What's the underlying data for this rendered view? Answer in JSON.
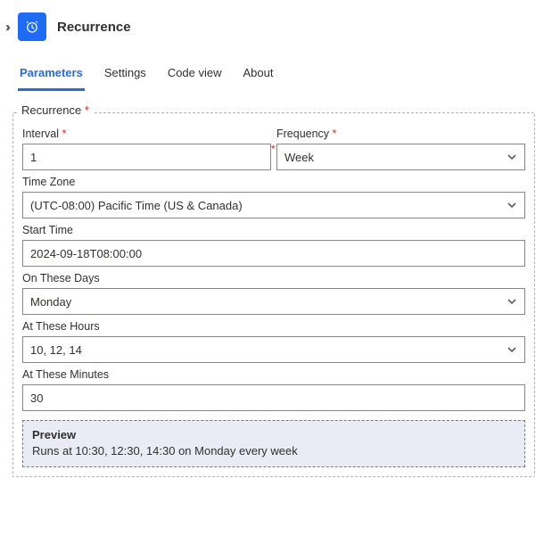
{
  "header": {
    "title": "Recurrence",
    "icon": "clock-icon"
  },
  "tabs": {
    "items": [
      {
        "label": "Parameters",
        "active": true
      },
      {
        "label": "Settings",
        "active": false
      },
      {
        "label": "Code view",
        "active": false
      },
      {
        "label": "About",
        "active": false
      }
    ]
  },
  "form": {
    "legend": "Recurrence",
    "interval": {
      "label": "Interval",
      "value": "1",
      "required": true
    },
    "frequency": {
      "label": "Frequency",
      "value": "Week",
      "required": true
    },
    "timezone": {
      "label": "Time Zone",
      "value": "(UTC-08:00) Pacific Time (US & Canada)"
    },
    "starttime": {
      "label": "Start Time",
      "value": "2024-09-18T08:00:00"
    },
    "days": {
      "label": "On These Days",
      "value": "Monday"
    },
    "hours": {
      "label": "At These Hours",
      "value": "10, 12, 14"
    },
    "minutes": {
      "label": "At These Minutes",
      "value": "30"
    },
    "preview": {
      "heading": "Preview",
      "text": "Runs at 10:30, 12:30, 14:30 on Monday every week"
    }
  }
}
